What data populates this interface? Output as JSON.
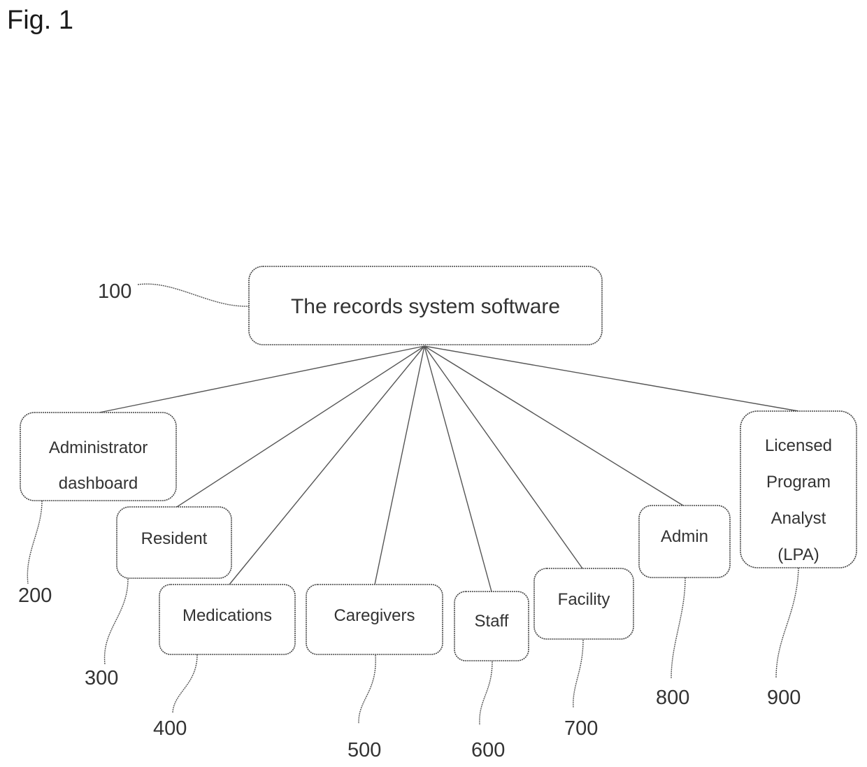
{
  "figure_label": "Fig. 1",
  "hub": {
    "id": "root",
    "ref": "100",
    "lines": [
      "The records system software"
    ]
  },
  "children": [
    {
      "id": "admin-dashboard",
      "ref": "200",
      "lines": [
        "Administrator",
        "dashboard"
      ]
    },
    {
      "id": "resident",
      "ref": "300",
      "lines": [
        "Resident"
      ]
    },
    {
      "id": "medications",
      "ref": "400",
      "lines": [
        "Medications"
      ]
    },
    {
      "id": "caregivers",
      "ref": "500",
      "lines": [
        "Caregivers"
      ]
    },
    {
      "id": "staff",
      "ref": "600",
      "lines": [
        "Staff"
      ]
    },
    {
      "id": "facility",
      "ref": "700",
      "lines": [
        "Facility"
      ]
    },
    {
      "id": "admin",
      "ref": "800",
      "lines": [
        "Admin"
      ]
    },
    {
      "id": "lpa",
      "ref": "900",
      "lines": [
        "Licensed",
        "Program",
        "Analyst",
        "(LPA)"
      ]
    }
  ],
  "edges": [
    [
      "root",
      "admin-dashboard"
    ],
    [
      "root",
      "resident"
    ],
    [
      "root",
      "medications"
    ],
    [
      "root",
      "caregivers"
    ],
    [
      "root",
      "staff"
    ],
    [
      "root",
      "facility"
    ],
    [
      "root",
      "admin"
    ],
    [
      "root",
      "lpa"
    ]
  ]
}
